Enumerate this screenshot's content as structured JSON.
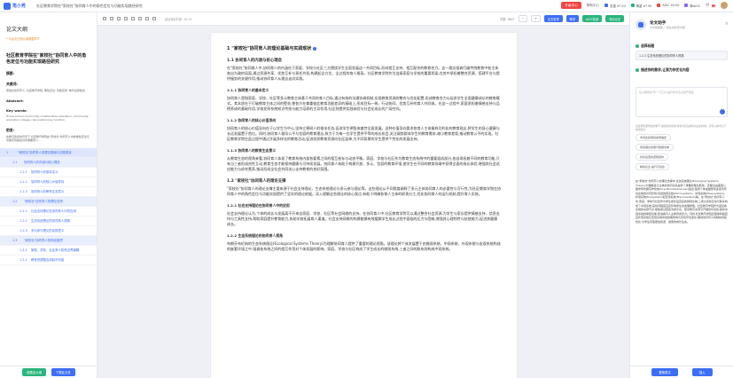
{
  "app": {
    "logo": "笔小秀",
    "doc_title": "社区教育学院在\"家校社\"协同育人中的角色定位与功能实现路径研究",
    "actions": {
      "upgrade": "升级中心",
      "help": "帮助中心"
    },
    "badges": [
      {
        "label": "查重 ¥7.00",
        "color": "#3d6ef7"
      },
      {
        "label": "降重 ¥7.00",
        "color": "#29b57c"
      },
      {
        "label": "AIGC ¥4.00",
        "color": "#f04444"
      },
      {
        "label": "降AIGC",
        "color": "#8a63f2"
      }
    ],
    "notif_count": "1"
  },
  "left": {
    "header": "论文大纲",
    "hint": "* 可点击左侧大纲调整章节",
    "title": "社区教育学院在\"家校社\"协同育人中的角色定位与功能实现路径研究",
    "abstract_label": "摘要:",
    "keywords_label": "关键词:",
    "keywords": "家校社协同育人; 社区教育学院; 角色定位; 功能实现; 教育资源整合",
    "abstract_en_label": "Abstract:",
    "keywords_en_label": "Key words:",
    "keywords_en": "Home-school-community collaborative education; community education college; role positioning; function",
    "preface_label": "前言:",
    "preface": "在教育改革的背景下,社区教育学院在\"家校社\"协同育人中的角色定位与功能实现路径具有重要意义...",
    "outline": [
      {
        "num": "1",
        "label": "\"家校社\"协同育人的理论基础与实践现状",
        "level": 0
      },
      {
        "num": "1.1",
        "label": "协同育人的内涵与核心理念",
        "level": 1
      },
      {
        "num": "1.1.1",
        "label": "协同育人的基本定义",
        "level": 2
      },
      {
        "num": "1.1.2",
        "label": "协同育人的核心价值导向",
        "level": 2
      },
      {
        "num": "1.1.3",
        "label": "协同育人的教育生态意义",
        "level": 2
      },
      {
        "num": "1.2",
        "label": "\"家校社\"协同育人的理论支撑",
        "level": 1
      },
      {
        "num": "1.2.1",
        "label": "社会支持理论在协同育人中的应用",
        "level": 2
      },
      {
        "num": "1.2.2",
        "label": "生态系统理论的协同育人视角",
        "level": 2
      },
      {
        "num": "1.2.3",
        "label": "多元参与理论的实践意义",
        "level": 2
      },
      {
        "num": "1.3",
        "label": "\"家校社\"协同育人的现实困境",
        "level": 1
      },
      {
        "num": "1.3.1",
        "label": "家庭、学校、社区育人权责边界模糊",
        "level": 2
      },
      {
        "num": "1.3.2",
        "label": "教育资源整合机制不完善",
        "level": 2
      }
    ],
    "btn_outline": "收藏此大纲",
    "btn_export": "下载此文件"
  },
  "toolbar": {
    "autosave": "最近保存时间: 10:15",
    "wordcount": "字数: 3807",
    "btn_dup": "论文查重",
    "btn_polish": "降重",
    "btn_aigc": "AIGC检测",
    "btn_export": "导出论文"
  },
  "paper": {
    "sections": [
      {
        "type": "h1",
        "text": "1 \"家校社\"协同育人的理论基础与实践现状"
      },
      {
        "type": "h2",
        "text": "1.1 协同育人的内涵与核心理念"
      },
      {
        "type": "p",
        "text": "在\"家校社\"协同育人中,协同育人的内涵在于家庭、学校与社区三方围绕学生全面发展这一共同目标,形成相互支持、相互配合的教育合力。这一理念强调打破传统教育中各主体各自为政的局面,通过资源共享、优势互补与责任共担,构建起全方位、全过程的育人格局。社区教育学院作为连接家庭与学校的重要桥梁,在其中承担着整合资源、搭建平台与提供服务的关键作用,推动协同育人从理念走向实践。"
      },
      {
        "type": "h3",
        "text": "1.1.1 协同育人的基本定义"
      },
      {
        "type": "p",
        "text": "协同育人是指家庭、学校、社区等多元教育主体基于共同的育人目标,通过有效的沟通协调机制,实现教育资源的整合与优化配置,形成教育合力以促进学生全面健康成长的教育模式。其本质在于打破教育主体之间的壁垒,使各方在尊重彼此教育功能差异的基础上,形成目标一致、行动协同、优势互补的育人共同体。在这一过程中,家庭承担着情感支持与品德养成的基础作用,学校发挥系统知识传授与能力培养的主导作用,社区则提供实践体验与社会化成长的广阔空间。"
      },
      {
        "type": "h3",
        "text": "1.1.2 协同育人的核心价值导向"
      },
      {
        "type": "p",
        "text": "协同育人的核心价值导向在于以学生为中心,坚持立德树人的根本任务,促进学生德智体美劳全面发展。这种价值导向要求各育人主体摒弃功利化的教育观念,将学生的身心健康与长远发展置于首位。同时,协同育人倡导公平与包容的教育理念,致力于为每一位学生提供平等的成长机会,关注弱势群体学生的教育需求,缩小教育差距,推动教育公平的实现。社区教育学院在此过程中通过开展多样化的教育活动,促进优质教育资源向社区延伸,为不同背景的学生提供个性化的发展支持。"
      },
      {
        "type": "h3",
        "text": "1.1.3 协同育人的教育生态意义"
      },
      {
        "type": "p",
        "text": "从教育生态的视角来看,协同育人体现了教育系统内部各要素之间的相互依存与动态平衡。家庭、学校与社区作为教育生态系统中的重要组成部分,各自承担着不同的教育功能,只有当三者形成良性互动,教育生态才能保持健康与可持续发展。协同育人有助于构建开放、多元、包容的教育环境,使学生在不同的教育场域中获得全面的成长体验,增强其社会适应能力与综合素养,推动形成全社会共同关心支持教育的良好氛围。"
      },
      {
        "type": "h2",
        "text": "1.2 \"家校社\"协同育人的理论支撑"
      },
      {
        "type": "p",
        "text": "\"家校社\"协同育人的理论支撑主要来源于社会支持理论、生态系统理论与多元参与理论等。这些理论从不同角度阐释了多元主体协同育人的必要性与可行性,为社区教育学院在协同育人中的角色定位与功能实现提供了坚实的理论依据。深入理解这些理论的核心观点,有助于明确各育人主体的职责分工,优化协同育人的运行机制,提升育人实效。"
      },
      {
        "type": "h3",
        "text": "1.2.1 社会支持理论在协同育人中的应用"
      },
      {
        "type": "p",
        "text": "社会支持理论认为,个体的成长与发展离不开来自家庭、学校、社区等社会网络的支持。在协同育人中,社区教育学院可以通过整合社会资源,为学生与家长提供情感支持、信息支持与工具性支持,帮助家庭提升教育能力,协助学校拓展育人渠道。社会支持网络的构建能够有效缓解学生成长过程中面临的压力与困难,增强其心理韧性与抗挫能力,促进其健康成长。"
      },
      {
        "type": "h3",
        "text": "1.2.2 生态系统理论的协同育人视角"
      },
      {
        "type": "p",
        "text": "布朗芬布伦纳的生态系统理论(Ecological Systems Theory)为理解协同育人提供了重要的理论视角。该理论将个体发展置于由微观系统、中观系统、外观系统与宏观系统构成的嵌套环境之中,强调各系统之间的相互作用对个体发展的影响。家庭、学校与社区构成了学生成长的微观系统,三者之间的联系则构成中观系统。"
      }
    ]
  },
  "right": {
    "title": "论文助手",
    "subtitle": "AI智能辅助,一键生成优质内容",
    "sec1": "选择标题",
    "sec1_value": "1.2.2 生态系统理论的协同育人视角",
    "sec2": "描述你的需求,让我为你优化内容",
    "input_placeholder": "如:请帮我扩写一下正文,提升学术表达的严谨性",
    "tip": "请选择需要修改的章节,描述您的需求,我将为您生成优化后的内容。您可以参考以下常用指令:",
    "chips": [
      "丰富此段落的案例描述",
      "增加理论依据与数据支撑",
      "优化段落的逻辑结构",
      "精简表达,提升可读性"
    ],
    "answer": "在\"家校社\"协同育人的理论支撑中,生态系统理论(Ecological Systems Theory)为理解多元主体的协同关系提供了重要的理论框架。该理论由美国心理学家布朗芬布伦纳(Urie Bronfenbrenner)提出,强调个体发展受到多层次环境系统的共同影响,包括微观系统(Microsystem)、中观系统(Mesosystem)、外观系统(Exosystem)和宏观系统(Macrosystem)等。在\"家校社\"协同育人中,家庭、学校与社区作为学生成长最直接的微观系统,三者之间的互动与联系构成了中观系统,其协同程度直接影响学生的发展质量。社区教育学院作为连接各系统的关键节点,能够通过搭建沟通平台、整合教育资源与开展协同活动,强化中观系统的联结功能,促进各育人主体形成合力。同时,社区教育学院还能够积极回应外观系统与宏观系统中的政策导向与文化环境变化,推动协同育人机制的持续优化,为学生营造更加和谐、健康的成长生态。",
    "btn_replace": "替换原文",
    "btn_insert": "插入"
  }
}
